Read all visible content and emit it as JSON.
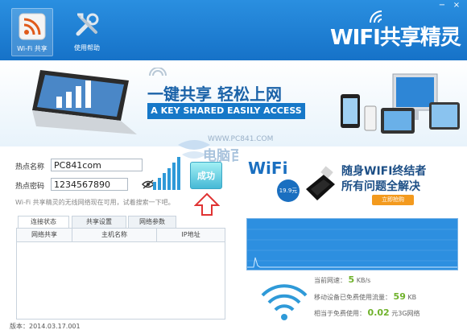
{
  "toolbar": {
    "wifi_share_label": "Wi-Fi 共享",
    "help_label": "使用帮助"
  },
  "brand": "WIFI共享精灵",
  "window_controls": [
    "−",
    "×"
  ],
  "banner": {
    "title": "一键共享 轻松上网",
    "subtitle": "A KEY SHARED EASILY ACCESS"
  },
  "watermark": {
    "url": "WWW.PC841.COM",
    "name": "电脑百事网"
  },
  "hotspot": {
    "name_label": "热点名称",
    "name_value": "PC841com",
    "password_label": "热点密码",
    "password_value": "1234567890"
  },
  "success_button": "成功",
  "status_text": "Wi-Fi 共享精灵的无线网络现在可用，试着搜索一下吧。",
  "tabs": [
    "连接状态",
    "共享设置",
    "网络参数"
  ],
  "table_headers": [
    "网络共享",
    "主机名称",
    "IP地址"
  ],
  "version": "版本：2014.03.17.001",
  "ad": {
    "logo": "WiFi",
    "badge": "19.9元",
    "line1": "随身WIFI终结者",
    "line2": "所有问题全解决",
    "button": "立即抢购"
  },
  "stats": {
    "speed_label": "当前网速：",
    "speed_value": "5",
    "speed_unit": "KB/s",
    "data_label": "移动设备已免费使用流量：",
    "data_value": "59",
    "data_unit": "KB",
    "saved_label": "相当于免费使用：",
    "saved_value": "0.02",
    "saved_unit": "元3G网络"
  }
}
